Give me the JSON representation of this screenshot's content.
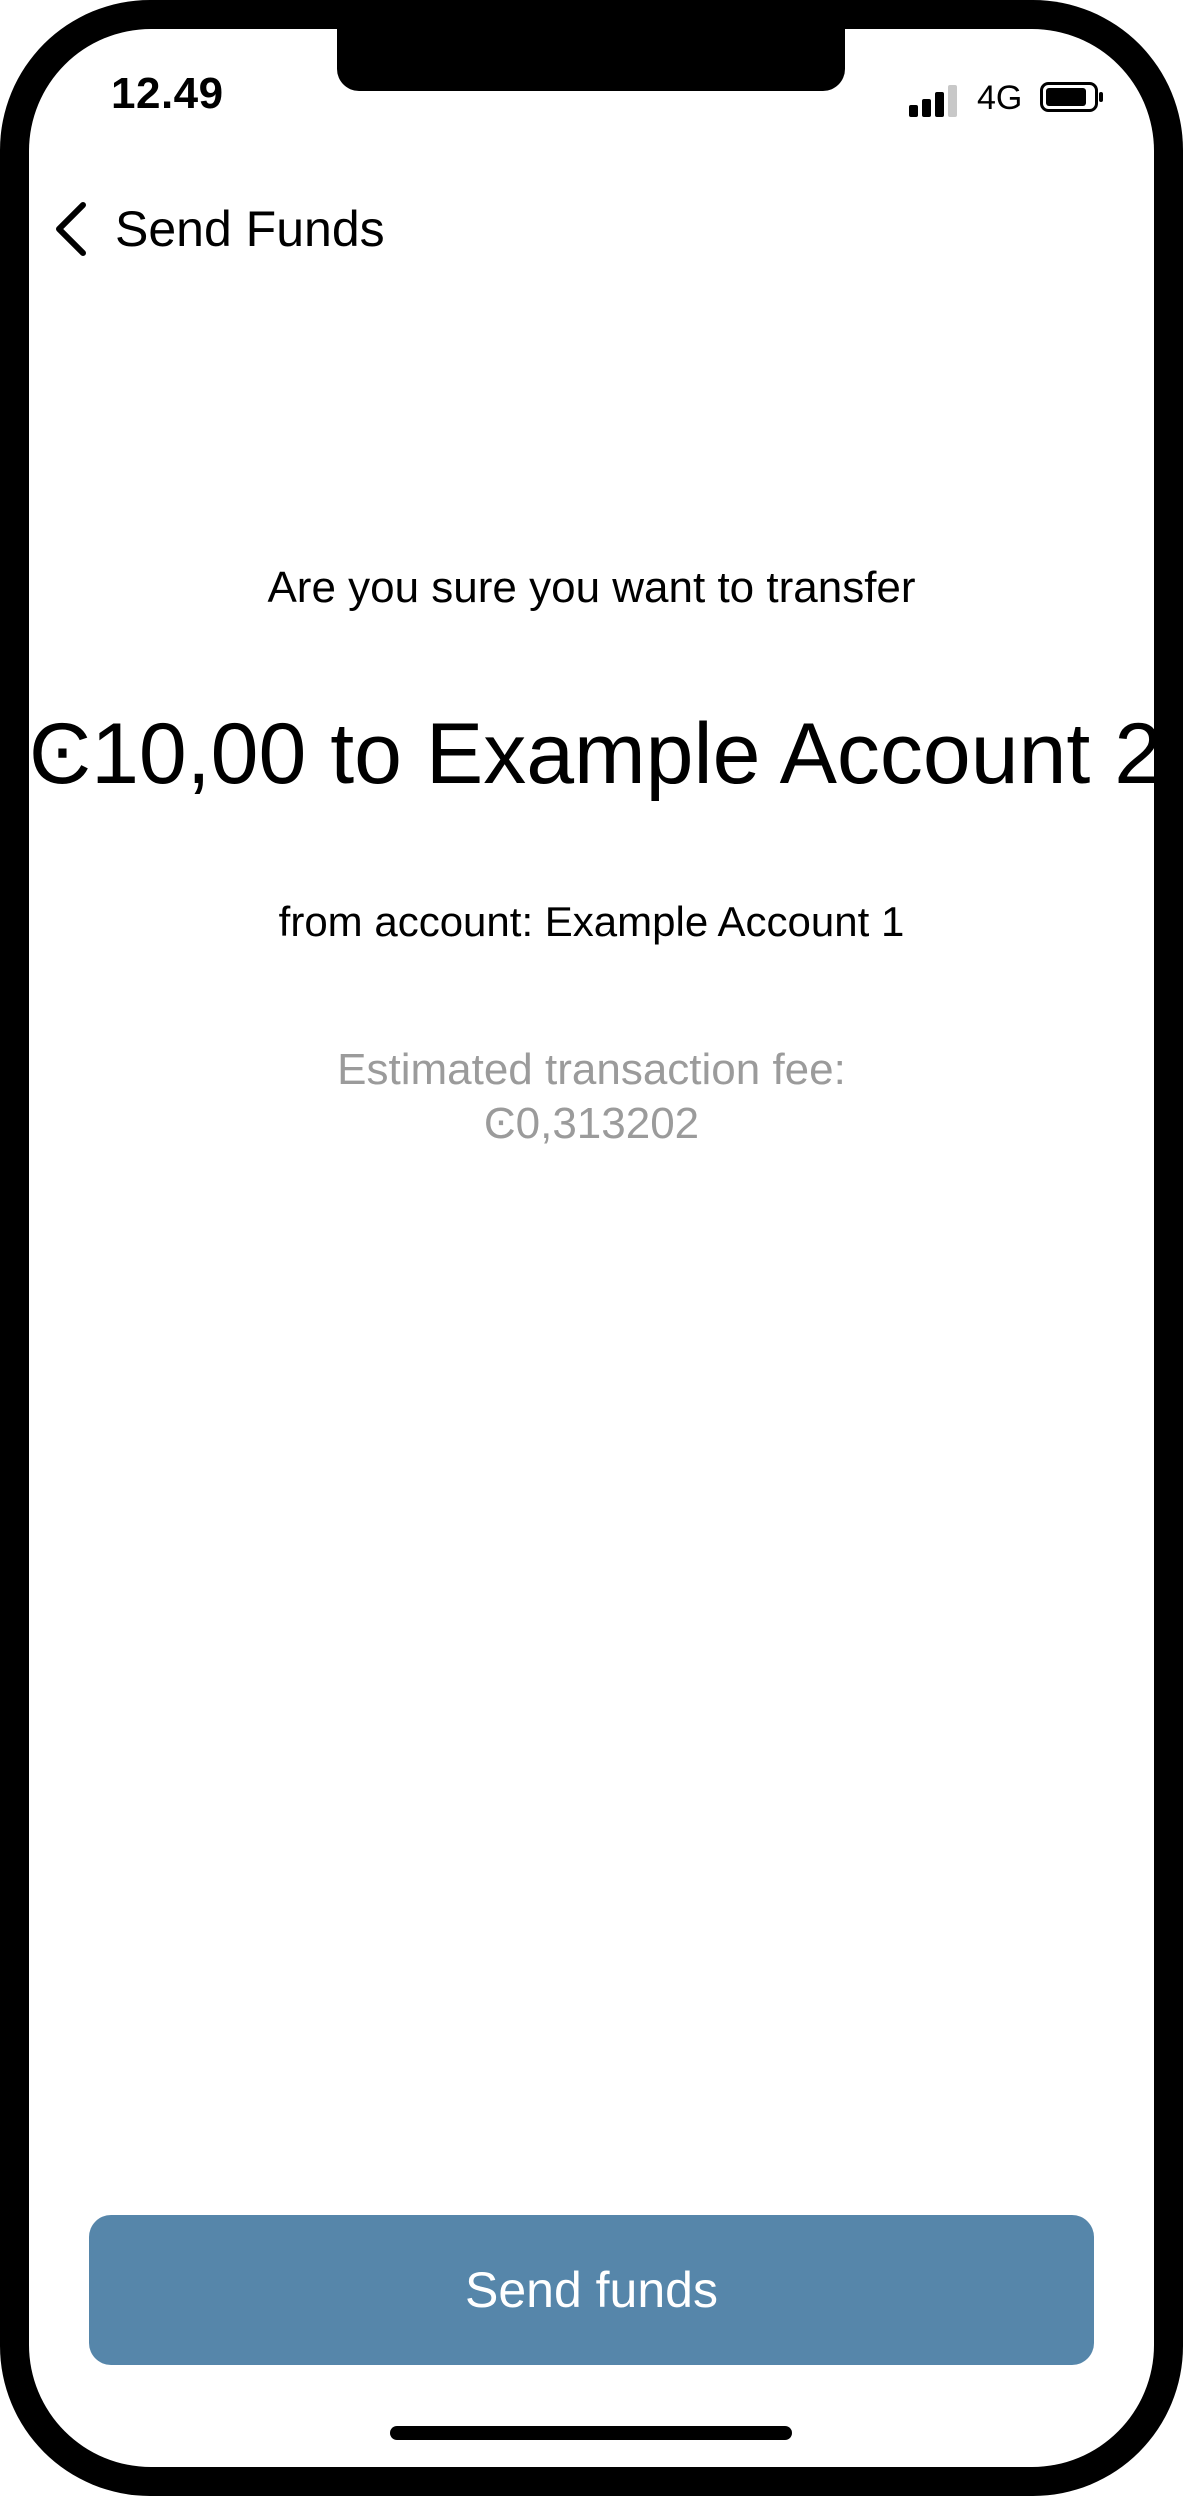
{
  "status_bar": {
    "time": "12.49",
    "network": "4G",
    "signal_icon": "cellular-signal-icon",
    "battery_icon": "battery-icon"
  },
  "header": {
    "back_icon": "chevron-left-icon",
    "title": "Send Funds"
  },
  "confirmation": {
    "prompt": "Are you sure you want to transfer",
    "summary": "Ͼ10,00 to Example Account 2",
    "from_line": "from account:  Example Account 1",
    "fee_label": "Estimated transaction fee:",
    "fee_value": "Ͼ0,313202"
  },
  "actions": {
    "send_label": "Send funds"
  },
  "colors": {
    "button": "#5686aa",
    "button_text": "#ffffff",
    "muted_text": "#9b9b9b",
    "text": "#000000"
  }
}
